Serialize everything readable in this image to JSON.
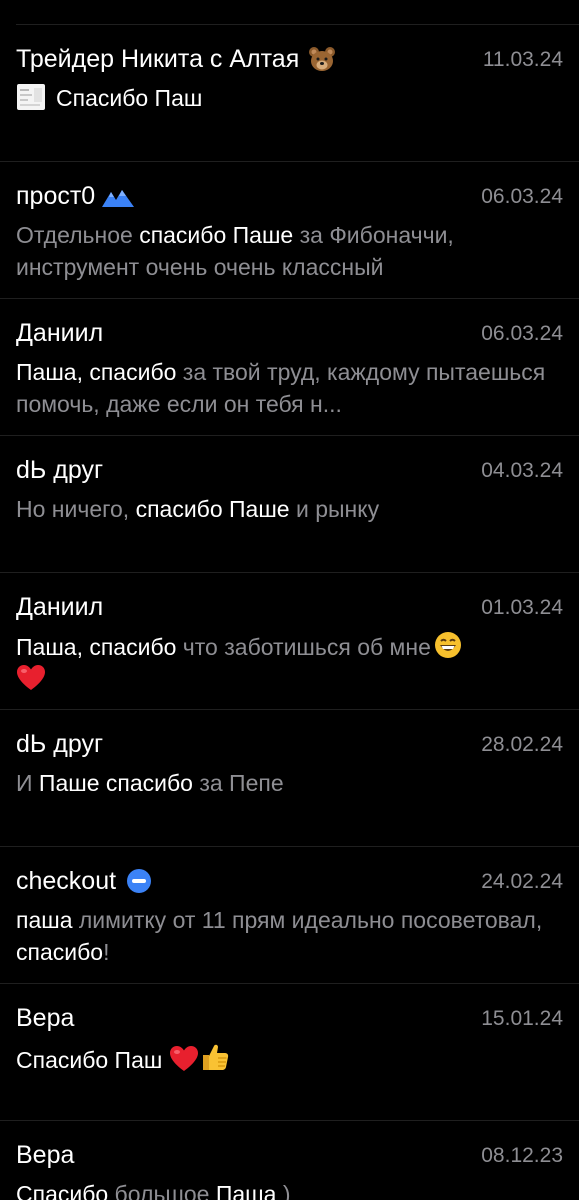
{
  "chats": [
    {
      "name": "Трейдер Никита с Алтая",
      "badge_icon": "bear-icon",
      "date": "11.03.24",
      "preview": [
        {
          "text": "Спасибо Паш",
          "highlight": true
        }
      ],
      "preview_icon": "doc-thumbnail-icon"
    },
    {
      "name": "прост0",
      "badge_icon": "verified-mountain-icon",
      "date": "06.03.24",
      "preview": [
        {
          "text": "Отдельное ",
          "highlight": false
        },
        {
          "text": "спасибо Паше",
          "highlight": true
        },
        {
          "text": " за Фибоначчи, инструмент очень очень классный",
          "highlight": false
        }
      ]
    },
    {
      "name": "Даниил",
      "date": "06.03.24",
      "preview": [
        {
          "text": "Паша, спасибо",
          "highlight": true
        },
        {
          "text": " за твой труд, каждому пытаешься помочь, даже если он тебя н...",
          "highlight": false
        }
      ]
    },
    {
      "name": "dЬ друг",
      "date": "04.03.24",
      "preview": [
        {
          "text": "Но ничего, ",
          "highlight": false
        },
        {
          "text": "спасибо Паше",
          "highlight": true
        },
        {
          "text": " и рынку",
          "highlight": false
        }
      ]
    },
    {
      "name": "Даниил",
      "date": "01.03.24",
      "preview": [
        {
          "text": "Паша, спасибо",
          "highlight": true
        },
        {
          "text": " что заботишься об мне",
          "highlight": false
        }
      ],
      "trailing_icons": [
        "grin-icon",
        "heart-icon"
      ]
    },
    {
      "name": "dЬ друг",
      "date": "28.02.24",
      "preview": [
        {
          "text": "И ",
          "highlight": false
        },
        {
          "text": "Паше спасибо",
          "highlight": true
        },
        {
          "text": " за Пепе",
          "highlight": false
        }
      ]
    },
    {
      "name": "checkout",
      "badge_icon": "minus-circle-icon",
      "date": "24.02.24",
      "preview": [
        {
          "text": "паша",
          "highlight": true
        },
        {
          "text": " лимитку от 11 прям идеально посоветовал, ",
          "highlight": false
        },
        {
          "text": "спасибо",
          "highlight": true
        },
        {
          "text": "!",
          "highlight": false
        }
      ]
    },
    {
      "name": "Вера",
      "date": "15.01.24",
      "preview": [
        {
          "text": "Спасибо Паш ",
          "highlight": true
        }
      ],
      "trailing_icons": [
        "heart-icon",
        "thumbs-up-icon"
      ]
    },
    {
      "name": "Вера",
      "date": "08.12.23",
      "preview": [
        {
          "text": "Спасибо",
          "highlight": true
        },
        {
          "text": " большое ",
          "highlight": false
        },
        {
          "text": "Паша",
          "highlight": true
        },
        {
          "text": " )",
          "highlight": false
        }
      ]
    }
  ],
  "colors": {
    "background": "#000000",
    "name": "#ffffff",
    "date": "#8e8e93",
    "preview_plain": "#8e8e93",
    "preview_highlight": "#ffffff",
    "divider": "#1f1f1f",
    "accent_blue": "#3b82f6"
  }
}
